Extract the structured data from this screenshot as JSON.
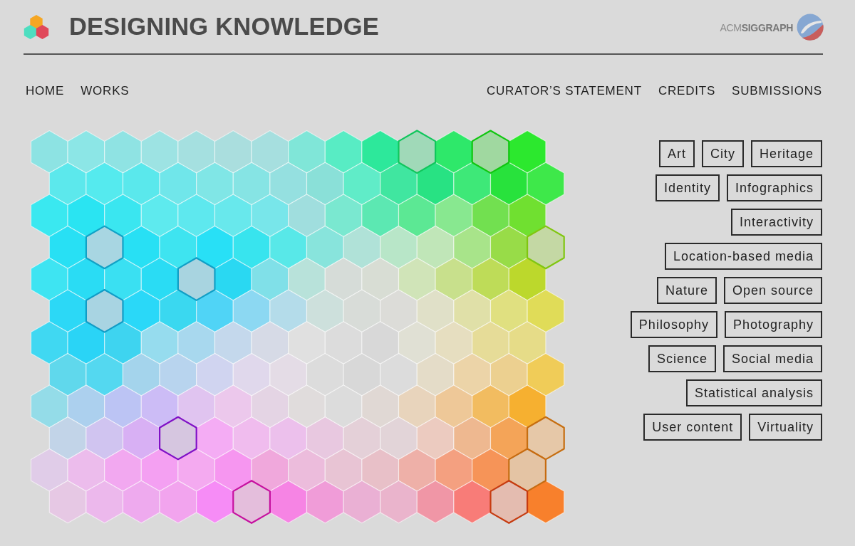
{
  "header": {
    "title": "DESIGNING KNOWLEDGE",
    "partner_logo": "ACM**SIGGRAPH**"
  },
  "nav": {
    "left": [
      {
        "label": "HOME"
      },
      {
        "label": "WORKS"
      }
    ],
    "right": [
      {
        "label": "CURATOR’S STATEMENT"
      },
      {
        "label": "CREDITS"
      },
      {
        "label": "SUBMISSIONS"
      }
    ]
  },
  "hex_map": {
    "rows": [
      {
        "cells": [
          {
            "color": "#8de3e3",
            "highlighted": false
          },
          {
            "color": "#8ce6e6",
            "highlighted": false
          },
          {
            "color": "#8fe3e3",
            "highlighted": false
          },
          {
            "color": "#9de3e3",
            "highlighted": false
          },
          {
            "color": "#a5e0e0",
            "highlighted": false
          },
          {
            "color": "#aadede",
            "highlighted": false
          },
          {
            "color": "#a6dfdf",
            "highlighted": false
          },
          {
            "color": "#80e6d8",
            "highlighted": false
          },
          {
            "color": "#58ecc4",
            "highlighted": false
          },
          {
            "color": "#2de89b",
            "highlighted": false
          },
          {
            "color": "#a0d9b8",
            "highlighted": true
          },
          {
            "color": "#2ee86a",
            "highlighted": false
          },
          {
            "color": "#a0d8a0",
            "highlighted": true
          },
          {
            "color": "#2ce82e",
            "highlighted": false
          }
        ]
      },
      {
        "cells": [
          {
            "color": "#5ce8ec",
            "highlighted": false
          },
          {
            "color": "#55eaee",
            "highlighted": false
          },
          {
            "color": "#5ae8ec",
            "highlighted": false
          },
          {
            "color": "#70e6ea",
            "highlighted": false
          },
          {
            "color": "#80e6e6",
            "highlighted": false
          },
          {
            "color": "#86e4e4",
            "highlighted": false
          },
          {
            "color": "#95e0e0",
            "highlighted": false
          },
          {
            "color": "#8ae0d8",
            "highlighted": false
          },
          {
            "color": "#60ecc8",
            "highlighted": false
          },
          {
            "color": "#40e6a0",
            "highlighted": false
          },
          {
            "color": "#28e283",
            "highlighted": false
          },
          {
            "color": "#3ee878",
            "highlighted": false
          },
          {
            "color": "#28e23c",
            "highlighted": false
          },
          {
            "color": "#3ee84a",
            "highlighted": false
          }
        ]
      },
      {
        "cells": [
          {
            "color": "#3ae8f0",
            "highlighted": false
          },
          {
            "color": "#2ae4f2",
            "highlighted": false
          },
          {
            "color": "#3ae6f0",
            "highlighted": false
          },
          {
            "color": "#5eeaee",
            "highlighted": false
          },
          {
            "color": "#5ee8ee",
            "highlighted": false
          },
          {
            "color": "#68e8ec",
            "highlighted": false
          },
          {
            "color": "#78e6ea",
            "highlighted": false
          },
          {
            "color": "#a0dede",
            "highlighted": false
          },
          {
            "color": "#7ae8d0",
            "highlighted": false
          },
          {
            "color": "#5ce8b2",
            "highlighted": false
          },
          {
            "color": "#5ce894",
            "highlighted": false
          },
          {
            "color": "#88e890",
            "highlighted": false
          },
          {
            "color": "#72e050",
            "highlighted": false
          },
          {
            "color": "#70e030",
            "highlighted": false
          }
        ]
      },
      {
        "cells": [
          {
            "color": "#28e0f4",
            "highlighted": false
          },
          {
            "color": "#a8d6e2",
            "highlighted": true
          },
          {
            "color": "#28e0f4",
            "highlighted": false
          },
          {
            "color": "#3ee4f0",
            "highlighted": false
          },
          {
            "color": "#28e0f6",
            "highlighted": false
          },
          {
            "color": "#38e4ee",
            "highlighted": false
          },
          {
            "color": "#58e8e8",
            "highlighted": false
          },
          {
            "color": "#88e4dc",
            "highlighted": false
          },
          {
            "color": "#b0e2d8",
            "highlighted": false
          },
          {
            "color": "#b8e6c8",
            "highlighted": false
          },
          {
            "color": "#c0e6b8",
            "highlighted": false
          },
          {
            "color": "#a8e48a",
            "highlighted": false
          },
          {
            "color": "#98dc48",
            "highlighted": false
          },
          {
            "color": "#c4d8a4",
            "highlighted": true
          }
        ]
      },
      {
        "cells": [
          {
            "color": "#3ee4f2",
            "highlighted": false
          },
          {
            "color": "#2adcf4",
            "highlighted": false
          },
          {
            "color": "#3ae0f2",
            "highlighted": false
          },
          {
            "color": "#2adcf4",
            "highlighted": false
          },
          {
            "color": "#a8d4e0",
            "highlighted": true
          },
          {
            "color": "#2ad8f2",
            "highlighted": false
          },
          {
            "color": "#80e0e8",
            "highlighted": false
          },
          {
            "color": "#b8e2da",
            "highlighted": false
          },
          {
            "color": "#d6dcd8",
            "highlighted": false
          },
          {
            "color": "#d8ddd4",
            "highlighted": false
          },
          {
            "color": "#d0e4b8",
            "highlighted": false
          },
          {
            "color": "#c8e08c",
            "highlighted": false
          },
          {
            "color": "#bedc58",
            "highlighted": false
          },
          {
            "color": "#bcd82c",
            "highlighted": false
          }
        ]
      },
      {
        "cells": [
          {
            "color": "#2cd8f6",
            "highlighted": false
          },
          {
            "color": "#a8d4e2",
            "highlighted": true
          },
          {
            "color": "#2ad8f8",
            "highlighted": false
          },
          {
            "color": "#3ad8f0",
            "highlighted": false
          },
          {
            "color": "#50d4f6",
            "highlighted": false
          },
          {
            "color": "#8cd8f2",
            "highlighted": false
          },
          {
            "color": "#b4dcea",
            "highlighted": false
          },
          {
            "color": "#cde0dc",
            "highlighted": false
          },
          {
            "color": "#d8dcd8",
            "highlighted": false
          },
          {
            "color": "#dcdcd8",
            "highlighted": false
          },
          {
            "color": "#e0e0c8",
            "highlighted": false
          },
          {
            "color": "#e0e0a8",
            "highlighted": false
          },
          {
            "color": "#e0e080",
            "highlighted": false
          },
          {
            "color": "#e0dc58",
            "highlighted": false
          }
        ]
      },
      {
        "cells": [
          {
            "color": "#40d8f2",
            "highlighted": false
          },
          {
            "color": "#2ad4f6",
            "highlighted": false
          },
          {
            "color": "#3ed4f0",
            "highlighted": false
          },
          {
            "color": "#96dcee",
            "highlighted": false
          },
          {
            "color": "#a8d8ee",
            "highlighted": false
          },
          {
            "color": "#c4d8ec",
            "highlighted": false
          },
          {
            "color": "#d6dae6",
            "highlighted": false
          },
          {
            "color": "#e0e0e0",
            "highlighted": false
          },
          {
            "color": "#dcdcdc",
            "highlighted": false
          },
          {
            "color": "#d8d8d8",
            "highlighted": false
          },
          {
            "color": "#e0e0d4",
            "highlighted": false
          },
          {
            "color": "#e6dec0",
            "highlighted": false
          },
          {
            "color": "#e6dc98",
            "highlighted": false
          },
          {
            "color": "#e6dc88",
            "highlighted": false
          }
        ]
      },
      {
        "cells": [
          {
            "color": "#60d8ec",
            "highlighted": false
          },
          {
            "color": "#54d8f0",
            "highlighted": false
          },
          {
            "color": "#a4d4ec",
            "highlighted": false
          },
          {
            "color": "#b8d4ee",
            "highlighted": false
          },
          {
            "color": "#d0d4f0",
            "highlighted": false
          },
          {
            "color": "#e0d8ec",
            "highlighted": false
          },
          {
            "color": "#e4dce6",
            "highlighted": false
          },
          {
            "color": "#dcdcdc",
            "highlighted": false
          },
          {
            "color": "#d8d8d8",
            "highlighted": false
          },
          {
            "color": "#dcdcdc",
            "highlighted": false
          },
          {
            "color": "#e4dcc8",
            "highlighted": false
          },
          {
            "color": "#ecd4a8",
            "highlighted": false
          },
          {
            "color": "#ecd090",
            "highlighted": false
          },
          {
            "color": "#f0cc58",
            "highlighted": false
          }
        ]
      },
      {
        "cells": [
          {
            "color": "#94dce8",
            "highlighted": false
          },
          {
            "color": "#acd0ee",
            "highlighted": false
          },
          {
            "color": "#bcc4f4",
            "highlighted": false
          },
          {
            "color": "#ccbcf6",
            "highlighted": false
          },
          {
            "color": "#e0c4f0",
            "highlighted": false
          },
          {
            "color": "#ecc8ec",
            "highlighted": false
          },
          {
            "color": "#e4d4e4",
            "highlighted": false
          },
          {
            "color": "#e0dcdc",
            "highlighted": false
          },
          {
            "color": "#dcdcdc",
            "highlighted": false
          },
          {
            "color": "#e0d8d4",
            "highlighted": false
          },
          {
            "color": "#e8d4bc",
            "highlighted": false
          },
          {
            "color": "#eec898",
            "highlighted": false
          },
          {
            "color": "#f2bc60",
            "highlighted": false
          },
          {
            "color": "#f6b030",
            "highlighted": false
          }
        ]
      },
      {
        "cells": [
          {
            "color": "#c2d4e8",
            "highlighted": false
          },
          {
            "color": "#d0c4f0",
            "highlighted": false
          },
          {
            "color": "#d8b0f4",
            "highlighted": false
          },
          {
            "color": "#d6c6e0",
            "highlighted": true
          },
          {
            "color": "#f4acf4",
            "highlighted": false
          },
          {
            "color": "#f0bcee",
            "highlighted": false
          },
          {
            "color": "#ecc0ec",
            "highlighted": false
          },
          {
            "color": "#e8c8e0",
            "highlighted": false
          },
          {
            "color": "#e4d0d8",
            "highlighted": false
          },
          {
            "color": "#e2d4d8",
            "highlighted": false
          },
          {
            "color": "#eccbc0",
            "highlighted": false
          },
          {
            "color": "#eeb890",
            "highlighted": false
          },
          {
            "color": "#f4a458",
            "highlighted": false
          },
          {
            "color": "#e6c8a8",
            "highlighted": true
          }
        ]
      },
      {
        "cells": [
          {
            "color": "#e0cce8",
            "highlighted": false
          },
          {
            "color": "#ecbcec",
            "highlighted": false
          },
          {
            "color": "#f2a8f0",
            "highlighted": false
          },
          {
            "color": "#f4a0f2",
            "highlighted": false
          },
          {
            "color": "#f4aaf0",
            "highlighted": false
          },
          {
            "color": "#f696f0",
            "highlighted": false
          },
          {
            "color": "#f0a8dc",
            "highlighted": false
          },
          {
            "color": "#ecbcdc",
            "highlighted": false
          },
          {
            "color": "#e8c4d4",
            "highlighted": false
          },
          {
            "color": "#e8c0c8",
            "highlighted": false
          },
          {
            "color": "#eeb0a8",
            "highlighted": false
          },
          {
            "color": "#f4a080",
            "highlighted": false
          },
          {
            "color": "#f69458",
            "highlighted": false
          },
          {
            "color": "#e4c4a4",
            "highlighted": true
          }
        ]
      },
      {
        "cells": [
          {
            "color": "#e6c8e4",
            "highlighted": false
          },
          {
            "color": "#ecb8ec",
            "highlighted": false
          },
          {
            "color": "#eeaaee",
            "highlighted": false
          },
          {
            "color": "#f2a4ee",
            "highlighted": false
          },
          {
            "color": "#f68cf6",
            "highlighted": false
          },
          {
            "color": "#e4bedc",
            "highlighted": true
          },
          {
            "color": "#f684e4",
            "highlighted": false
          },
          {
            "color": "#f09cd8",
            "highlighted": false
          },
          {
            "color": "#eab0d4",
            "highlighted": false
          },
          {
            "color": "#eab4cc",
            "highlighted": false
          },
          {
            "color": "#f096a6",
            "highlighted": false
          },
          {
            "color": "#f87c78",
            "highlighted": false
          },
          {
            "color": "#e4bcb0",
            "highlighted": true
          },
          {
            "color": "#f8802c",
            "highlighted": false
          }
        ]
      }
    ]
  },
  "tags": {
    "rows": [
      {
        "items": [
          "Art",
          "City",
          "Heritage"
        ]
      },
      {
        "items": [
          "Identity",
          "Infographics"
        ]
      },
      {
        "items": [
          "Interactivity"
        ]
      },
      {
        "items": [
          "Location-based media"
        ]
      },
      {
        "items": [
          "Nature",
          "Open source"
        ]
      },
      {
        "items": [
          "Philosophy",
          "Photography"
        ]
      },
      {
        "items": [
          "Science",
          "Social media"
        ]
      },
      {
        "items": [
          "Statistical analysis"
        ]
      },
      {
        "items": [
          "User content",
          "Virtuality"
        ]
      }
    ]
  }
}
